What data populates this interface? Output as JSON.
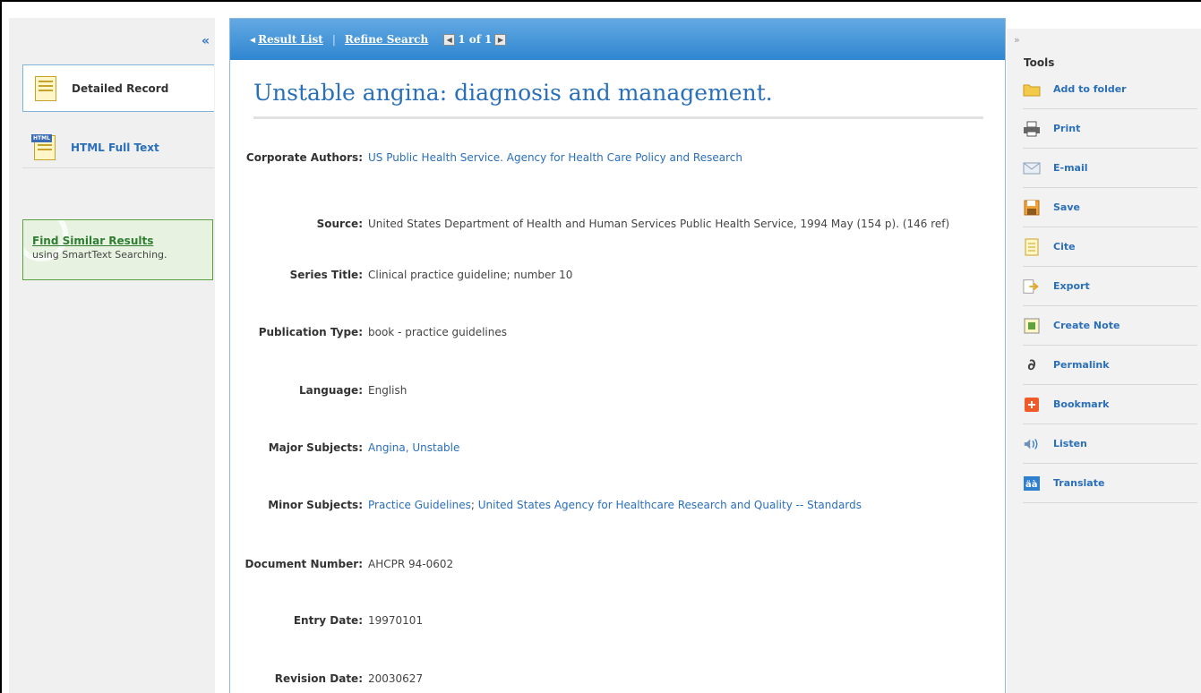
{
  "left_panel": {
    "collapse_glyph": "«",
    "nav": [
      {
        "label": "Detailed Record",
        "icon": "document-icon"
      },
      {
        "label": "HTML Full Text",
        "icon": "html-document-icon"
      }
    ],
    "similar": {
      "link": "Find Similar Results",
      "subtitle": "using SmartText Searching."
    }
  },
  "main": {
    "toolbar": {
      "result_list": "Result List",
      "refine_search": "Refine Search",
      "pager_text": "1 of 1"
    },
    "title": "Unstable angina: diagnosis and management.",
    "fields": {
      "corporate_authors": {
        "label": "Corporate Authors:",
        "value": "US Public Health Service. Agency for Health Care Policy and Research"
      },
      "source": {
        "label": "Source:",
        "value": "United States Department of Health and Human Services Public Health Service, 1994 May (154 p). (146 ref)"
      },
      "series_title": {
        "label": "Series Title:",
        "value": "Clinical practice guideline; number 10"
      },
      "publication_type": {
        "label": "Publication Type:",
        "value": "book - practice guidelines"
      },
      "language": {
        "label": "Language:",
        "value": "English"
      },
      "major_subjects": {
        "label": "Major Subjects:",
        "value": "Angina, Unstable"
      },
      "minor_subjects": {
        "label": "Minor Subjects:",
        "value_1": "Practice Guidelines",
        "value_2": "United States Agency for Healthcare Research and Quality -- Standards"
      },
      "document_number": {
        "label": "Document Number:",
        "value": "AHCPR 94-0602"
      },
      "entry_date": {
        "label": "Entry Date:",
        "value": "19970101"
      },
      "revision_date": {
        "label": "Revision Date:",
        "value": "20030627"
      }
    }
  },
  "tools": {
    "expand_glyph": "»",
    "title": "Tools",
    "items": [
      {
        "label": "Add to folder",
        "icon": "folder-icon"
      },
      {
        "label": "Print",
        "icon": "printer-icon"
      },
      {
        "label": "E-mail",
        "icon": "email-icon"
      },
      {
        "label": "Save",
        "icon": "save-icon"
      },
      {
        "label": "Cite",
        "icon": "cite-icon"
      },
      {
        "label": "Export",
        "icon": "export-icon"
      },
      {
        "label": "Create Note",
        "icon": "note-icon"
      },
      {
        "label": "Permalink",
        "icon": "link-icon"
      },
      {
        "label": "Bookmark",
        "icon": "bookmark-icon"
      },
      {
        "label": "Listen",
        "icon": "speaker-icon"
      },
      {
        "label": "Translate",
        "icon": "translate-icon"
      }
    ]
  },
  "colors": {
    "link": "#2a6fb9",
    "header_blue": "#2f86d0",
    "similar_green": "#2e7d32"
  }
}
